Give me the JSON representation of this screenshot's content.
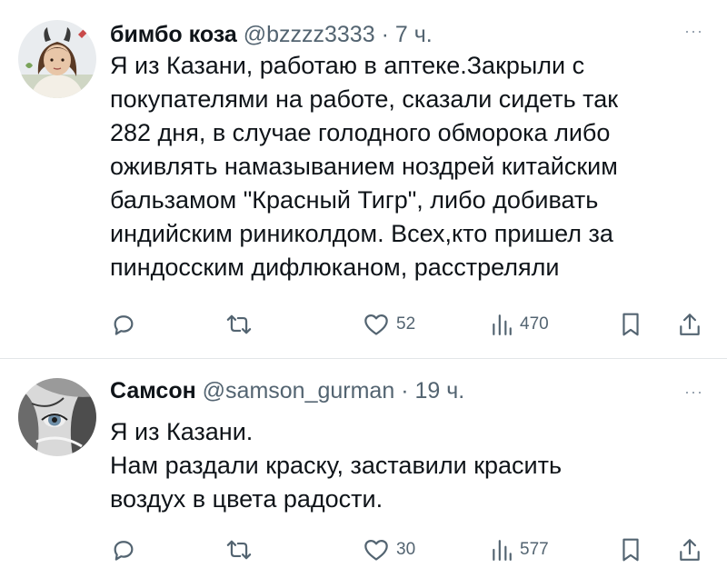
{
  "tweets": [
    {
      "author_name": "бимбо коза",
      "handle": "@bzzzz3333",
      "separator": "·",
      "time": "7 ч.",
      "more": "···",
      "lines": [
        "Я из Казани, работаю в аптеке.Закрыли с",
        "покупателями на работе, сказали сидеть так",
        "282 дня, в случае голодного обморока либо",
        "оживлять намазыванием ноздрей китайским",
        "бальзамом \"Красный Тигр\", либо добивать",
        "индийским риниколдом. Всех,кто пришел за",
        "пиндосским дифлюканом, расстреляли"
      ],
      "likes": "52",
      "views": "470"
    },
    {
      "author_name": "Самсон",
      "handle": "@samson_gurman",
      "separator": "·",
      "time": "19 ч.",
      "more": "···",
      "lines": [
        "Я из Казани.",
        "Нам раздали краску, заставили красить",
        "воздух в цвета радости."
      ],
      "likes": "30",
      "views": "577"
    }
  ],
  "icons": {
    "reply": "reply-icon",
    "retweet": "retweet-icon",
    "like": "heart-icon",
    "views": "views-icon",
    "bookmark": "bookmark-icon",
    "share": "share-icon"
  },
  "colors": {
    "text": "#0f1419",
    "secondary": "#536471",
    "divider": "#e3e6e8"
  }
}
